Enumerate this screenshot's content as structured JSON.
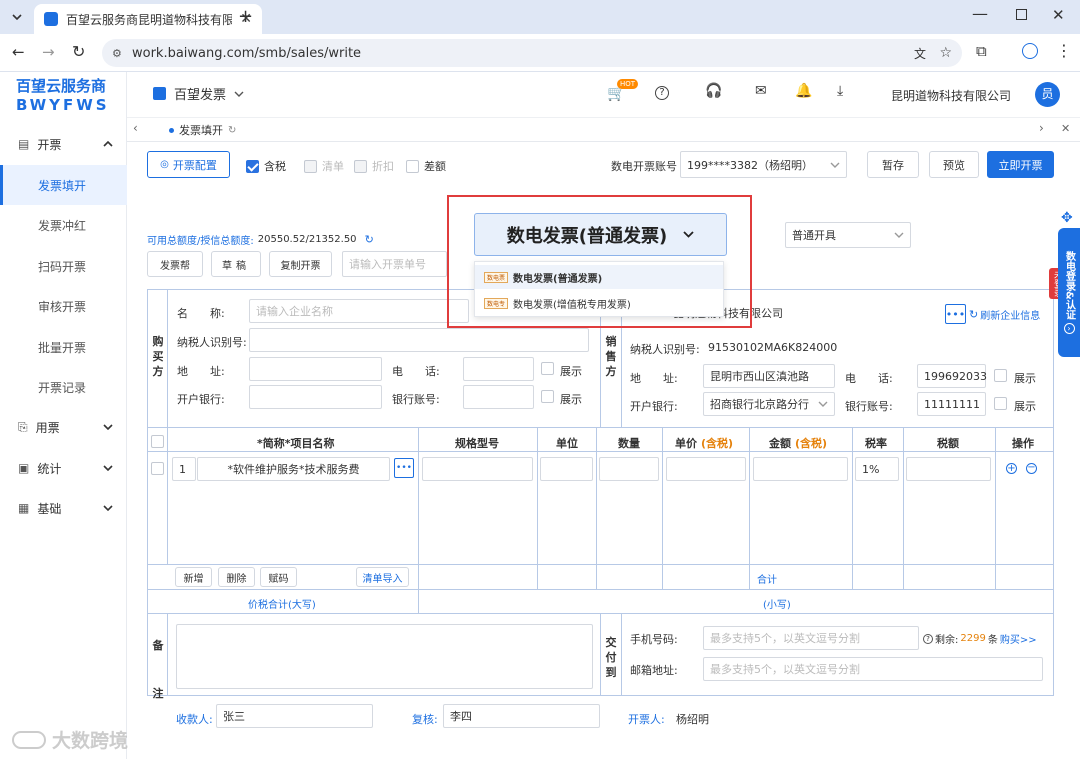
{
  "browser": {
    "tab_title": "百望云服务商昆明道物科技有限公司",
    "url": "work.baiwang.com/smb/sales/write"
  },
  "brand": {
    "line1": "百望云服务商",
    "line2": "BWYFWS"
  },
  "sidebar": {
    "group_open": {
      "label": "开票"
    },
    "items": [
      "发票填开",
      "发票冲红",
      "扫码开票",
      "审核开票",
      "批量开票",
      "开票记录"
    ],
    "groups": [
      "用票",
      "统计",
      "基础"
    ]
  },
  "topnav": {
    "product": "百望发票",
    "hot_badge": "HOT",
    "company": "昆明道物科技有限公司",
    "avatar": "员"
  },
  "pagetab": {
    "label": "发票填开"
  },
  "toolbar": {
    "config_button": "开票配置",
    "checks": [
      {
        "label": "含税",
        "checked": true
      },
      {
        "label": "清单",
        "checked": false
      },
      {
        "label": "折扣",
        "checked": false
      },
      {
        "label": "差额",
        "checked": false
      }
    ],
    "account_label": "数电开票账号",
    "account_value": "199****3382（杨绍明）",
    "buttons": [
      "暂存",
      "预览"
    ],
    "primary_button": "立即开票"
  },
  "quota": {
    "label": "可用总额度/授信总额度:",
    "value": "20550.52/21352.50"
  },
  "actions": [
    "发票帮",
    "草稿",
    "复制开票"
  ],
  "invoice_no_placeholder": "请输入开票单号",
  "invoice_type": {
    "selected": "数电发票(普通发票)",
    "options": [
      {
        "tag": "数电票",
        "label": "数电发票(普通发票)"
      },
      {
        "tag": "数电专",
        "label": "数电发票(增值税专用发票)"
      }
    ]
  },
  "issue_mode": "普通开具",
  "buyer": {
    "side_label": [
      "购",
      "买",
      "方"
    ],
    "name_label": "名　　称:",
    "name_placeholder": "请输入企业名称",
    "tax_label": "纳税人识别号:",
    "addr_label": "地　　址:",
    "tel_label": "电　　话:",
    "bank_label": "开户银行:",
    "account_label": "银行账号:",
    "show_label": "展示"
  },
  "seller": {
    "side_label": [
      "销",
      "售",
      "方"
    ],
    "name_value": "昆明道物科技有限公司",
    "refresh_label": "刷新企业信息",
    "tax_label": "纳税人识别号:",
    "tax_value": "91530102MA6K824000",
    "addr_label": "地　　址:",
    "addr_value": "昆明市西山区滇池路",
    "tel_label": "电　　话:",
    "tel_value": "199692033",
    "bank_label": "开户银行:",
    "bank_value": "招商银行北京路分行",
    "account_label": "银行账号:",
    "account_value": "11111111",
    "show_label": "展示"
  },
  "items_table": {
    "headers": [
      "*简称*项目名称",
      "规格型号",
      "单位",
      "数量",
      "单价",
      "金额",
      "税率",
      "税额",
      "操作"
    ],
    "tax_suffix": "(含税)",
    "rows": [
      {
        "no": "1",
        "name": "*软件维护服务*技术服务费",
        "rate": "1%"
      }
    ],
    "row_buttons": [
      "新增",
      "删除",
      "赋码"
    ],
    "import_button": "清单导入",
    "total_label": "合计",
    "total_words_label": "价税合计(大写)",
    "total_small_label": "(小写)"
  },
  "remark": {
    "side_label": [
      "备",
      "注"
    ]
  },
  "delivery": {
    "side_label": [
      "交",
      "付",
      "到"
    ],
    "phone_label": "手机号码:",
    "phone_placeholder": "最多支持5个，以英文逗号分割",
    "remaining_label": "剩余:",
    "remaining_value": "2299",
    "remaining_unit": "条",
    "buy_label": "购买>>",
    "email_label": "邮箱地址:",
    "email_placeholder": "最多支持5个，以英文逗号分割"
  },
  "signers": {
    "payee_label": "收款人:",
    "payee_value": "张三",
    "reviewer_label": "复核:",
    "reviewer_value": "李四",
    "drawer_label": "开票人:",
    "drawer_value": "杨绍明"
  },
  "right_float": {
    "label": "数电登录&认证",
    "badge": "未登录"
  },
  "watermark": "大数跨境",
  "colors": {
    "accent": "#1d6fe0",
    "highlight_border": "#e03c3c",
    "orange": "#e5820c"
  }
}
